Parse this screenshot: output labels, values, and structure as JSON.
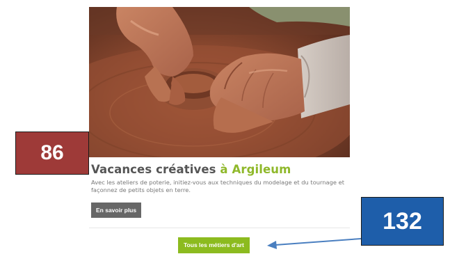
{
  "card": {
    "image_alt": "Mains façonnant une poterie en argile sur un tour",
    "title_main": "Vacances créatives ",
    "title_accent": "à Argileum",
    "description": "Avec les ateliers de poterie, initiez-vous aux techniques du modelage et du tournage et façonnez de petits objets en terre.",
    "more_button": "En savoir plus"
  },
  "footer": {
    "all_trades_button": "Tous les métiers d'art"
  },
  "annotations": {
    "red_badge": "86",
    "blue_badge": "132"
  },
  "colors": {
    "accent_green": "#8cbb1f",
    "title_accent": "#8fb82a",
    "title_grey": "#555555",
    "button_grey": "#676767",
    "badge_red": "#9e3a38",
    "badge_blue": "#1e5eaa",
    "arrow_blue": "#4a7fc0"
  }
}
